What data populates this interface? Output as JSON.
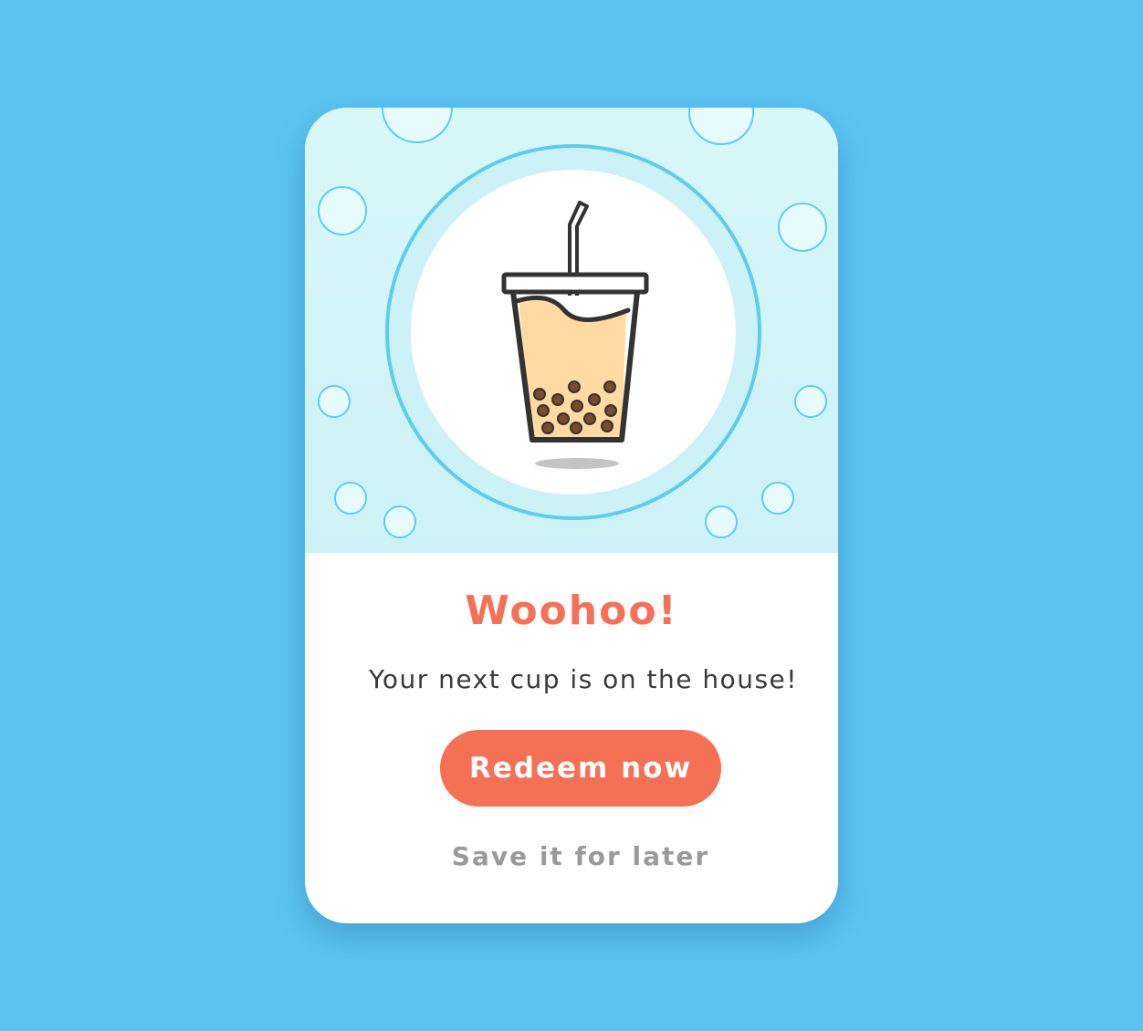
{
  "dialog": {
    "title": "Woohoo!",
    "message": "Your next cup is on the house!",
    "primary_button_label": "Redeem now",
    "secondary_link_label": "Save it for later"
  },
  "illustration": {
    "icon": "bubble-tea-icon",
    "decoration": "bubbles"
  },
  "colors": {
    "page_background": "#5bc3f1",
    "card_background": "#ffffff",
    "hero_background": "#d4f4f7",
    "accent": "#f47155",
    "bubble_stroke": "#5bcdf0",
    "tea_fill": "#ffdba3",
    "outline": "#333333",
    "secondary_text": "#9a9a9a"
  }
}
